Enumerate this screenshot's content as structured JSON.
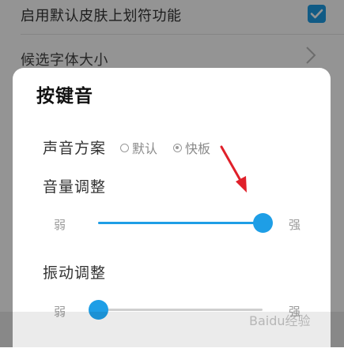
{
  "background": {
    "row1_label": "启用默认皮肤上划符功能",
    "row1_checked": true,
    "row2_label": "候选字体大小"
  },
  "dialog": {
    "title": "按键音",
    "sound_scheme_label": "声音方案",
    "sound_options": [
      {
        "label": "默认",
        "selected": false
      },
      {
        "label": "快板",
        "selected": true
      }
    ],
    "volume_label": "音量调整",
    "volume": {
      "min_label": "弱",
      "max_label": "强",
      "value": 1.0
    },
    "vibration_label": "振动调整",
    "vibration": {
      "min_label": "弱",
      "max_label": "强",
      "value": 0.0
    }
  },
  "watermark": "Baidu经验",
  "colors": {
    "accent": "#1e9ee6",
    "annotation_arrow": "#e0202a"
  }
}
